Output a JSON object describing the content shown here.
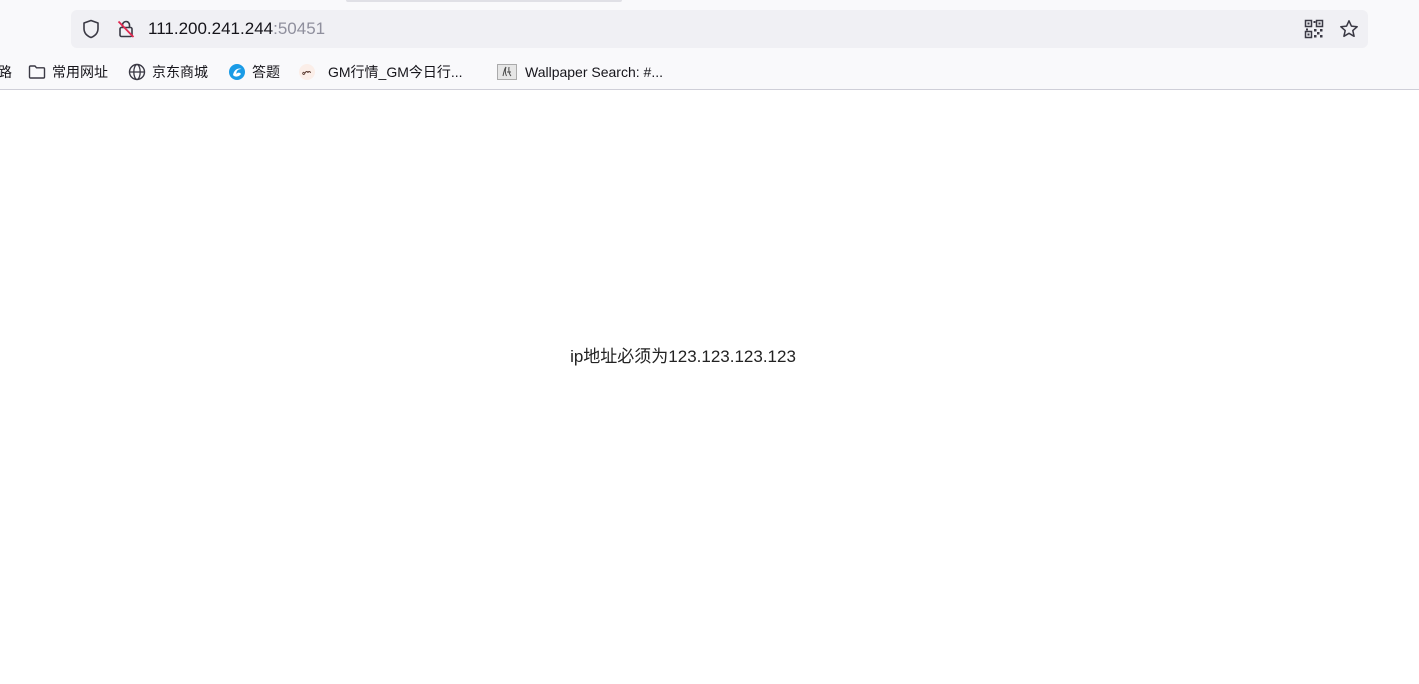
{
  "urlbar": {
    "host": "111.200.241.244",
    "port": ":50451",
    "icons": [
      "shield-icon",
      "insecure-lock-icon",
      "qr-code-icon",
      "star-icon"
    ]
  },
  "bookmarks": [
    {
      "label": "路",
      "icon": "none"
    },
    {
      "label": "常用网址",
      "icon": "folder-icon"
    },
    {
      "label": "京东商城",
      "icon": "globe-icon"
    },
    {
      "label": "答题",
      "icon": "site-favicon"
    },
    {
      "label": "GM行情_GM今日行...",
      "icon": "gm-favicon"
    },
    {
      "label": "Wallpaper Search: #...",
      "icon": "wallpaper-favicon"
    }
  ],
  "page": {
    "message": "ip地址必须为123.123.123.123"
  },
  "colors": {
    "toolbar_bg": "#f9f9fb",
    "urlbar_bg": "#f0f0f4",
    "port_text": "#8f8f9d",
    "insecure_red": "#e22850"
  }
}
